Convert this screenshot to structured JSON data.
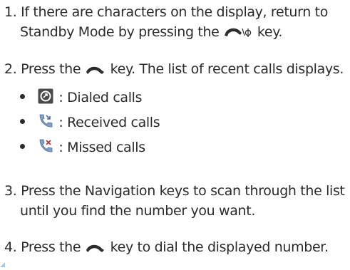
{
  "steps": [
    {
      "num": "1.",
      "line1_a": "If there are characters on the display, return to",
      "line2_a": "Standby Mode by pressing the",
      "line2_b": "key."
    },
    {
      "num": "2.",
      "line1_a": "Press the",
      "line1_b": "key. The list of recent calls displays."
    },
    {
      "num": "3.",
      "line1_a": "Press the Navigation keys to scan through the list",
      "line2_a": "until you find the number you want."
    },
    {
      "num": "4.",
      "line1_a": "Press the",
      "line1_b": "key to dial the displayed number."
    }
  ],
  "call_types": [
    {
      "label": ": Dialed calls",
      "icon": "dialed-calls-icon"
    },
    {
      "label": ": Received calls",
      "icon": "received-calls-icon"
    },
    {
      "label": ": Missed calls",
      "icon": "missed-calls-icon"
    }
  ],
  "icons": {
    "end_key": "end-power-key-icon",
    "send_key": "send-key-icon"
  },
  "colors": {
    "text": "#2b2b2b",
    "dialed_bg": "#4a4a4a",
    "received_blue": "#7f9fc9",
    "corner_mark": "#a8c8e6"
  }
}
